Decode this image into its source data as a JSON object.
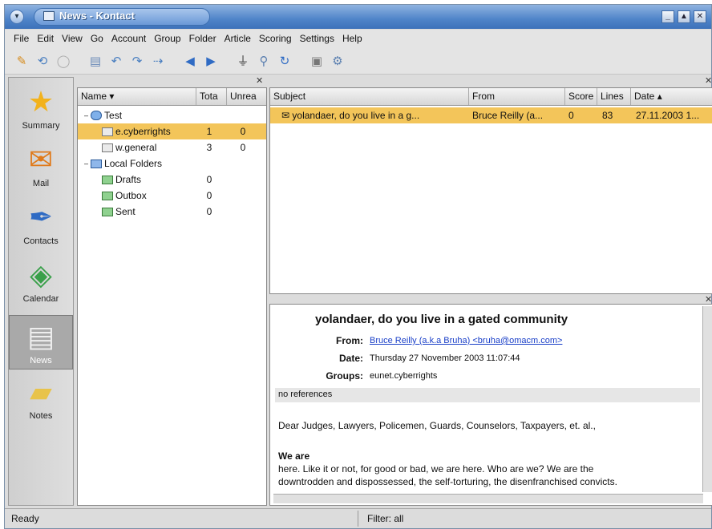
{
  "window": {
    "title": "News - Kontact",
    "controls": [
      "_",
      "▲",
      "✕"
    ]
  },
  "menubar": {
    "items": [
      "File",
      "Edit",
      "View",
      "Go",
      "Account",
      "Group",
      "Folder",
      "Article",
      "Scoring",
      "Settings",
      "Help"
    ]
  },
  "sidebar": {
    "items": [
      {
        "label": "Summary",
        "icon": "star-icon"
      },
      {
        "label": "Mail",
        "icon": "mail-icon"
      },
      {
        "label": "Contacts",
        "icon": "contacts-icon"
      },
      {
        "label": "Calendar",
        "icon": "calendar-icon"
      },
      {
        "label": "News",
        "icon": "news-icon",
        "active": true
      },
      {
        "label": "Notes",
        "icon": "notes-icon"
      }
    ]
  },
  "folders": {
    "columns": [
      "Name",
      "Tota",
      "Unrea"
    ],
    "rows": [
      {
        "name": "Test",
        "total": "",
        "unread": "",
        "type": "account"
      },
      {
        "name": "e.cyberrights",
        "total": "1",
        "unread": "0",
        "type": "group",
        "selected": true
      },
      {
        "name": "w.general",
        "total": "3",
        "unread": "0",
        "type": "group"
      },
      {
        "name": "Local Folders",
        "total": "",
        "unread": "",
        "type": "local"
      },
      {
        "name": "Drafts",
        "total": "0",
        "unread": "",
        "type": "folder"
      },
      {
        "name": "Outbox",
        "total": "0",
        "unread": "",
        "type": "folder"
      },
      {
        "name": "Sent",
        "total": "0",
        "unread": "",
        "type": "folder"
      }
    ]
  },
  "messages": {
    "columns": [
      "Subject",
      "From",
      "Score",
      "Lines",
      "Date"
    ],
    "rows": [
      {
        "subject": "yolandaer, do you live in a g...",
        "from": "Bruce Reilly (a...",
        "score": "0",
        "lines": "83",
        "date": "27.11.2003 1..."
      }
    ]
  },
  "article": {
    "subject": "yolandaer, do you live in a gated community",
    "from_label": "From:",
    "from_value": "Bruce Reilly (a.k.a Bruha) <bruha@omacm.com>",
    "date_label": "Date:",
    "date_value": "Thursday 27 November 2003 11:07:44",
    "groups_label": "Groups:",
    "groups_value": "eunet.cyberrights",
    "references": "no references",
    "body": [
      "Dear Judges, Lawyers, Policemen, Guards, Counselors, Taxpayers, et. al.,",
      "We are",
      "here.  Like it or not, for good or bad, we are here.  Who are we?  We are the",
      "downtrodden and dispossessed, the self-torturing, the disenfranchised convicts."
    ]
  },
  "status": {
    "left": "Ready",
    "right": "Filter: all"
  }
}
